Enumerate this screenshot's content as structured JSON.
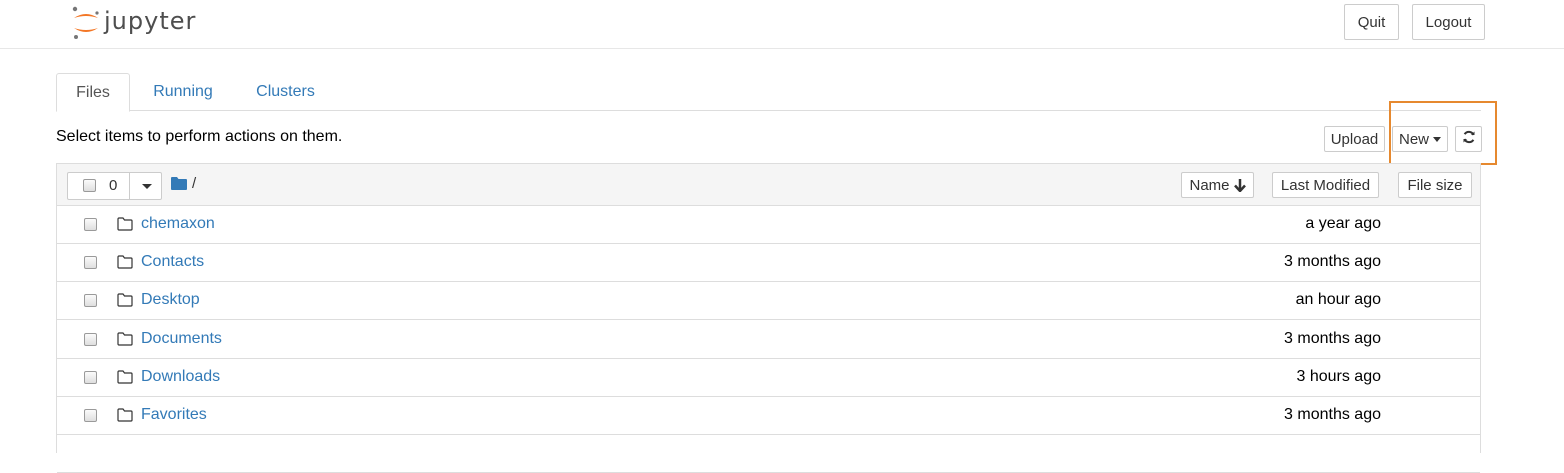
{
  "header": {
    "logo_text": "jupyter",
    "quit_label": "Quit",
    "logout_label": "Logout"
  },
  "tabs": [
    {
      "label": "Files",
      "active": true
    },
    {
      "label": "Running",
      "active": false
    },
    {
      "label": "Clusters",
      "active": false
    }
  ],
  "toolbar": {
    "instructions": "Select items to perform actions on them.",
    "upload_label": "Upload",
    "new_label": "New",
    "refresh_icon": "refresh-icon"
  },
  "list_header": {
    "selected_count": "0",
    "breadcrumb_root": "/",
    "sort_name_label": "Name",
    "sort_modified_label": "Last Modified",
    "sort_size_label": "File size"
  },
  "items": [
    {
      "name": "chemaxon",
      "modified": "a year ago",
      "type": "folder"
    },
    {
      "name": "Contacts",
      "modified": "3 months ago",
      "type": "folder"
    },
    {
      "name": "Desktop",
      "modified": "an hour ago",
      "type": "folder"
    },
    {
      "name": "Documents",
      "modified": "3 months ago",
      "type": "folder"
    },
    {
      "name": "Downloads",
      "modified": "3 hours ago",
      "type": "folder"
    },
    {
      "name": "Favorites",
      "modified": "3 months ago",
      "type": "folder"
    }
  ],
  "colors": {
    "link": "#337ab7",
    "highlight": "#e6892f",
    "logo_orange": "#f37726"
  }
}
